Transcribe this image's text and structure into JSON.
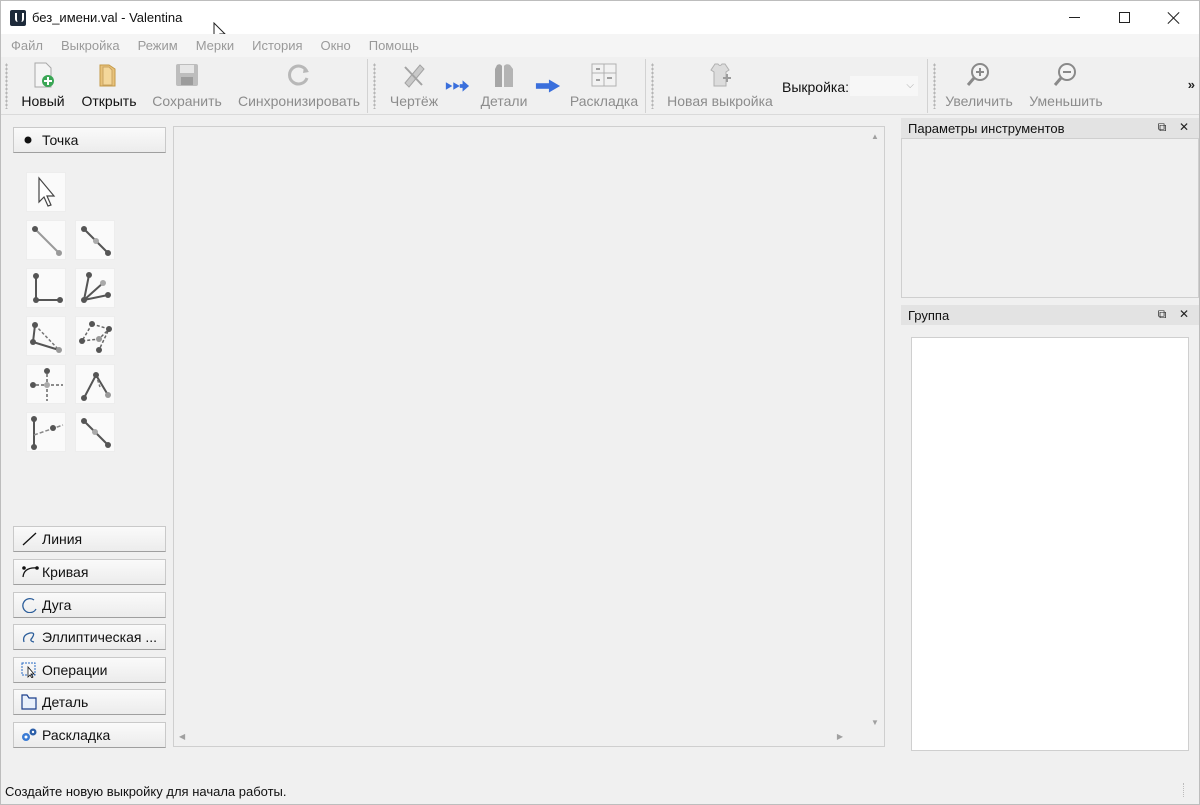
{
  "window": {
    "title": "без_имени.val - Valentina"
  },
  "menu": {
    "items": [
      "Файл",
      "Выкройка",
      "Режим",
      "Мерки",
      "История",
      "Окно",
      "Помощь"
    ]
  },
  "toolbar": {
    "new_label": "Новый",
    "open_label": "Открыть",
    "save_label": "Сохранить",
    "sync_label": "Синхронизировать",
    "draft_label": "Чертёж",
    "details_label": "Детали",
    "layout_label": "Раскладка",
    "new_pattern_label": "Новая выкройка",
    "pattern_combo_label": "Выкройка:",
    "pattern_combo_value": "",
    "zoom_in_label": "Увеличить",
    "zoom_out_label": "Уменьшить",
    "extension_label": "»"
  },
  "tool_panel": {
    "point_section": "Точка",
    "line_section": "Линия",
    "curve_section": "Кривая",
    "arc_section": "Дуга",
    "elliptical_section": "Эллиптическая ...",
    "operations_section": "Операции",
    "detail_section": "Деталь",
    "layout_section": "Раскладка"
  },
  "docks": {
    "tool_options_title": "Параметры инструментов",
    "group_title": "Группа"
  },
  "status": {
    "message": "Создайте новую выкройку  для начала работы."
  },
  "colors": {
    "accent_blue": "#3a6fdc",
    "disabled_text": "#8c8c8c",
    "icon_gray": "#7d7d7d"
  }
}
